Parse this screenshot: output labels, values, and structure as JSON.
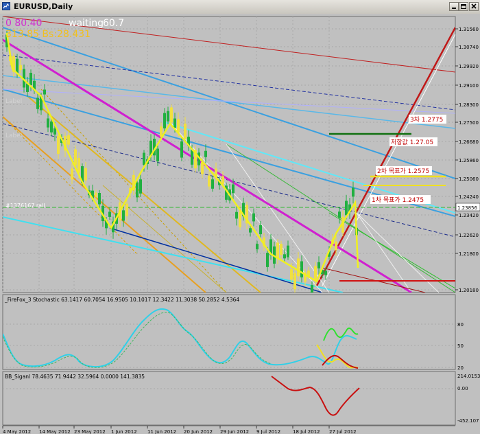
{
  "window": {
    "title": "EURUSD,Daily"
  },
  "overlay": {
    "line1_value": "0 80.40",
    "line1_status": "waiting",
    "line1_number": "60.7",
    "line2": "313.85 Bs:28.431"
  },
  "main_chart": {
    "faded_labels": [
      "Label",
      "Label"
    ],
    "ray_label": "#1376167 rall",
    "price_ticks": [
      "1.31560",
      "1.30740",
      "1.29920",
      "1.29100",
      "1.28300",
      "1.27500",
      "1.26680",
      "1.25860",
      "1.25060",
      "1.24240",
      "1.23856",
      "1.23420",
      "1.22620",
      "1.21800",
      "1.20180"
    ],
    "current_price": "1.23856",
    "target_labels": [
      "3차 1.2775",
      "저항값 1.27.05",
      "2차 목표가 1.2575",
      "1차 목표가 1.2475"
    ]
  },
  "stochastic": {
    "header": "_FireFox_3 Stochastic 63.1417 60.7054 16.9505 10.1017 12.3422 11.3038 50.2852 4.5364",
    "levels": [
      "80",
      "50",
      "20"
    ]
  },
  "bb_signal": {
    "header": "BB_Siganl 78.4635 71.9442 32.5964 0.0000 141.3835",
    "levels": [
      "214.0153",
      "0.00",
      "-452.107"
    ]
  },
  "time_axis": {
    "labels": [
      "4 May 2012",
      "14 May 2012",
      "23 May 2012",
      "1 Jun 2012",
      "11 Jun 2012",
      "20 Jun 2012",
      "29 Jun 2012",
      "9 Jul 2012",
      "18 Jul 2012",
      "27 Jul 2012"
    ]
  },
  "colors": {
    "background": "#c0c0c0",
    "bull_candle": "#f0e040",
    "bear_candle": "#20b040",
    "stoch_main": "#40c8e8",
    "bb_line": "#c81010"
  }
}
